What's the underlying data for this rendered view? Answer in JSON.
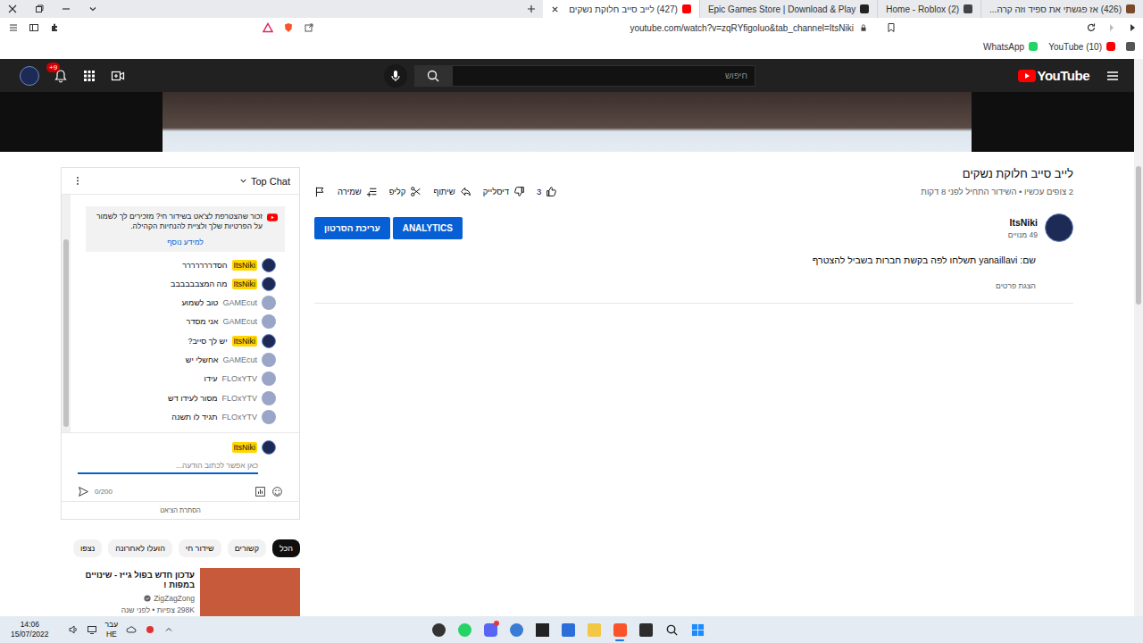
{
  "browser": {
    "tabs": [
      {
        "title": "(426) אז פגשתי את ספיד וזה קרה...",
        "selected": false
      },
      {
        "title": "(2) Home - Roblox",
        "selected": false
      },
      {
        "title": "Epic Games Store | Download & Play",
        "selected": false
      },
      {
        "title": "(427) לייב סייב חלוקת נשקים",
        "selected": true
      }
    ],
    "address": "youtube.com/watch?v=zqRYfigoluo&tab_channel=ItsNiki",
    "bookmarks": [
      {
        "label": "(10) YouTube",
        "color": "#ff0000"
      },
      {
        "label": "WhatsApp",
        "color": "#25d366"
      }
    ]
  },
  "header": {
    "logo": "YouTube",
    "search_placeholder": "חיפוש",
    "notifications": "+9"
  },
  "video": {
    "title": "לייב סייב חלוקת נשקים",
    "meta": "2 צופים עכשיו • השידור התחיל לפני 8 דקות",
    "actions": [
      {
        "kind": "like",
        "label": "3"
      },
      {
        "kind": "dislike",
        "label": "דיסלייק"
      },
      {
        "kind": "share",
        "label": "שיתוף"
      },
      {
        "kind": "clip",
        "label": "קליפ"
      },
      {
        "kind": "save",
        "label": "שמירה"
      }
    ]
  },
  "channel": {
    "name": "ItsNiki",
    "subscribers": "49 מנויים",
    "buttons": [
      "ANALYTICS",
      "עריכת הסרטון"
    ],
    "description": "שם: yanaillavi תשלחו לפה בקשת חברות בשביל להצטרף",
    "more": "הצגת פרטים"
  },
  "chat": {
    "title": "Top Chat",
    "notice": "זכור שהצטרפת לצ'אט בשידור חי? מזכירים לך לשמור על הפרטיות שלך ולציית להנחיות הקהילה.",
    "notice_link": "למידע נוסף",
    "messages": [
      {
        "author": "ItsNiki",
        "text": "הסדררררררר",
        "owner": true
      },
      {
        "author": "ItsNiki",
        "text": "מה המצבבבבבב",
        "owner": true
      },
      {
        "author": "GAMEcut",
        "text": "טוב לשמוע",
        "owner": false
      },
      {
        "author": "GAMEcut",
        "text": "אני מסדר",
        "owner": false
      },
      {
        "author": "ItsNiki",
        "text": "יש לך סייב?",
        "owner": true
      },
      {
        "author": "GAMEcut",
        "text": "אחשלי יש",
        "owner": false
      },
      {
        "author": "FLOxYTV",
        "text": "עידו",
        "owner": false
      },
      {
        "author": "FLOxYTV",
        "text": "מסור לעידו דש",
        "owner": false
      },
      {
        "author": "FLOxYTV",
        "text": "תגיד לו תשנה",
        "owner": false
      }
    ],
    "input_author": "ItsNiki",
    "placeholder": "כאן אפשר לכתוב הודעה...",
    "counter": "0/200",
    "hide": "הסתרת הצ'אט"
  },
  "chips": [
    {
      "label": "הכל",
      "selected": true
    },
    {
      "label": "קשורים",
      "selected": false
    },
    {
      "label": "שידור חי",
      "selected": false
    },
    {
      "label": "הועלו לאחרונה",
      "selected": false
    },
    {
      "label": "נצפו",
      "selected": false
    }
  ],
  "recommendations": [
    {
      "title": "עדכון חדש בפול גייז - שינויים במפות !",
      "channel": "ZigZagZong",
      "meta": "298K צפיות • לפני שנה",
      "verified": true
    }
  ],
  "taskbar": {
    "time": "14:06",
    "date": "15/07/2022",
    "lang_top": "עבר",
    "lang_bottom": "HE"
  }
}
